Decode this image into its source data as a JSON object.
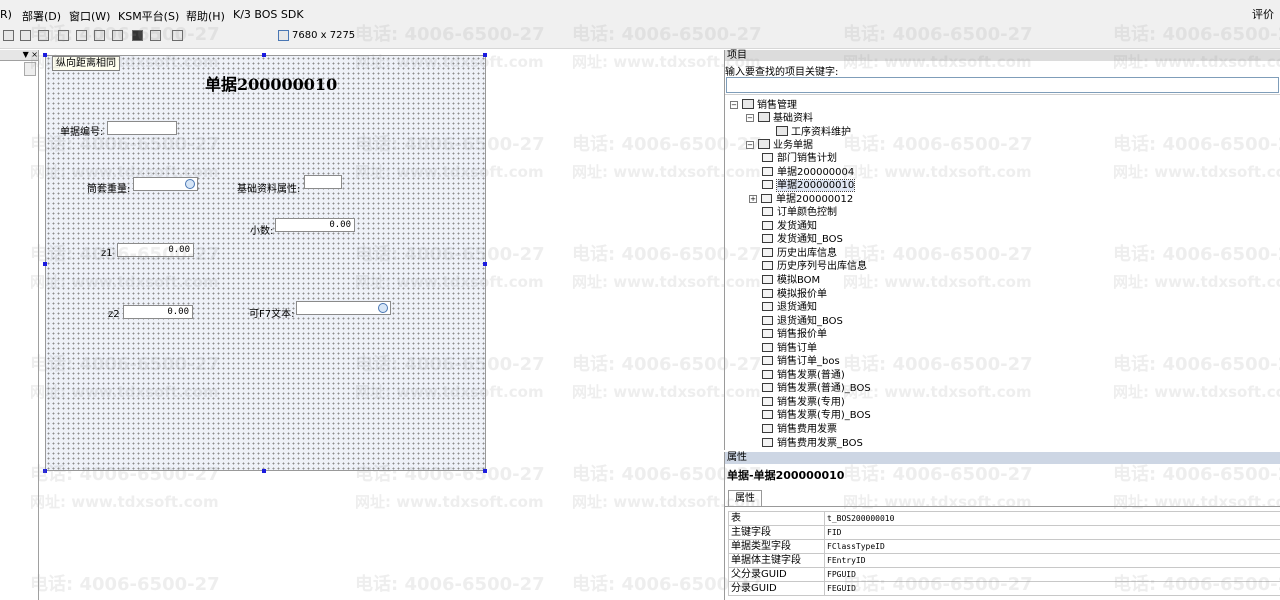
{
  "menubar": {
    "items": [
      "R)",
      "部署(D)",
      "窗口(W)",
      "KSM平台(S)",
      "帮助(H)",
      "K/3 BOS SDK"
    ],
    "right_text": "评价"
  },
  "toolbar": {
    "size_readout": "7680 x 7275"
  },
  "left_panel": {
    "header_text": "▼ ×"
  },
  "designer": {
    "tooltip": "纵向距离相同",
    "form_title": "单据200000010",
    "fields": {
      "bill_no_label": "单据编号:",
      "weight_label": "筒套重量:",
      "basic_attr_label": "基础资料属性:",
      "decimal_label": "小数:",
      "decimal_value": "0.00",
      "z1_label": "z1",
      "z1_value": "0.00",
      "z2_label": "z2",
      "z2_value": "0.00",
      "f7_label": "可F7文本:"
    }
  },
  "project_panel": {
    "caption": "项目",
    "search_hint": "输入要查找的项目关键字:",
    "tree": {
      "root": "销售管理",
      "basic": "基础资料",
      "basic_child": "工序资料维护",
      "business": "业务单据",
      "business_items": [
        "部门销售计划",
        "单据200000004",
        "单据200000010",
        "单据200000012",
        "订单颜色控制",
        "发货通知",
        "发货通知_BOS",
        "历史出库信息",
        "历史序列号出库信息",
        "模拟BOM",
        "模拟报价单",
        "退货通知",
        "退货通知_BOS",
        "销售报价单",
        "销售订单",
        "销售订单_bos",
        "销售发票(普通)",
        "销售发票(普通)_BOS",
        "销售发票(专用)",
        "销售发票(专用)_BOS",
        "销售费用发票",
        "销售费用发票_BOS"
      ],
      "selected_item": "单据200000010"
    }
  },
  "properties_panel": {
    "caption": "属性",
    "title": "单据-单据200000010",
    "tab": "属性",
    "rows": [
      {
        "key": "表",
        "value": "t_BOS200000010"
      },
      {
        "key": "主键字段",
        "value": "FID"
      },
      {
        "key": "单据类型字段",
        "value": "FClassTypeID"
      },
      {
        "key": "单据体主键字段",
        "value": "FEntryID"
      },
      {
        "key": "父分录GUID",
        "value": "FPGUID"
      },
      {
        "key": "分录GUID",
        "value": "FEGUID"
      }
    ]
  },
  "watermark": {
    "phone": "电话: 4006-6500-27",
    "site": "网址: www.tdxsoft.com"
  }
}
